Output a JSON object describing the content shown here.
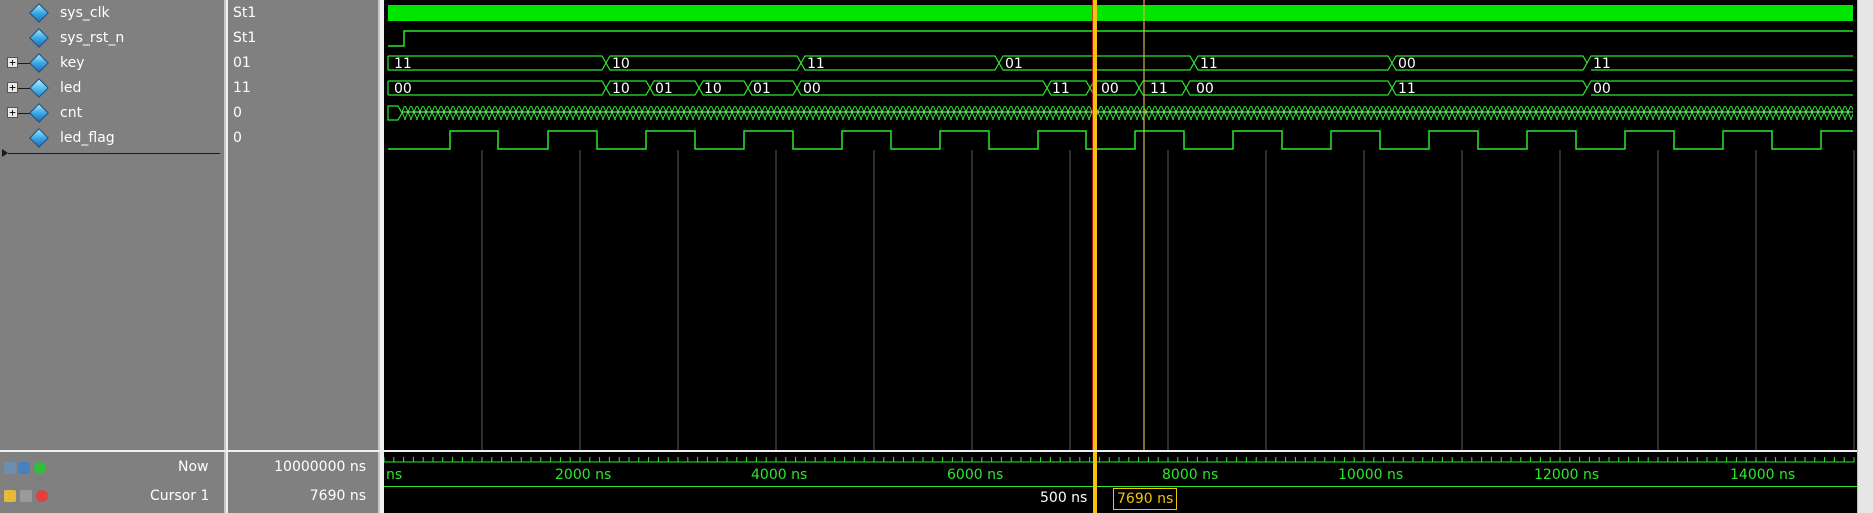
{
  "signals": [
    {
      "name": "sys_clk",
      "value": "St1",
      "expandable": false
    },
    {
      "name": "sys_rst_n",
      "value": "St1",
      "expandable": false
    },
    {
      "name": "key",
      "value": "01",
      "expandable": true
    },
    {
      "name": "led",
      "value": "11",
      "expandable": true
    },
    {
      "name": "cnt",
      "value": "0",
      "expandable": true
    },
    {
      "name": "led_flag",
      "value": "0",
      "expandable": false
    }
  ],
  "footer": {
    "now_label": "Now",
    "now_value": "10000000 ns",
    "cursor_label": "Cursor 1",
    "cursor_value": "7690 ns"
  },
  "timeline": {
    "start_label": "ns",
    "ticks": [
      "2000 ns",
      "4000 ns",
      "6000 ns",
      "8000 ns",
      "10000 ns",
      "12000 ns",
      "14000 ns"
    ],
    "cursor_time": "7690 ns",
    "delta_label": "500 ns"
  },
  "bus_values": {
    "key": [
      "11",
      "10",
      "11",
      "01",
      "11",
      "00",
      "11"
    ],
    "led": [
      "00",
      "10",
      "01",
      "10",
      "01",
      "00",
      "11",
      "00",
      "11",
      "00",
      "11",
      "00"
    ]
  },
  "colors": {
    "wave": "#2ee62e",
    "clock_fill": "#00e600",
    "cursor": "#f4c20d",
    "marker": "#e02020",
    "grid": "#5a5a5a"
  }
}
